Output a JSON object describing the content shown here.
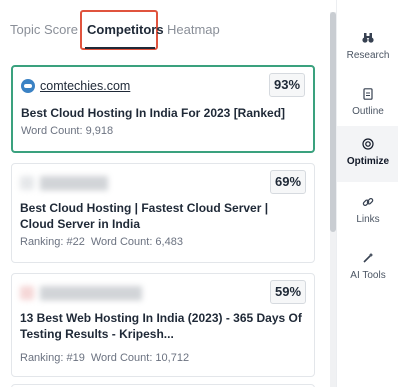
{
  "tabs": {
    "topic_score": "Topic Score",
    "competitors": "Competitors",
    "heatmap": "Heatmap"
  },
  "cards": [
    {
      "site": "comtechies.com",
      "score": "93%",
      "title": "Best Cloud Hosting In India For 2023 [Ranked]",
      "word_count": "Word Count: 9,918"
    },
    {
      "score": "69%",
      "title": "Best Cloud Hosting | Fastest Cloud Server | Cloud Server in India",
      "ranking": "Ranking: #22",
      "word_count": "Word Count: 6,483"
    },
    {
      "score": "59%",
      "title": "13 Best Web Hosting In India (2023) - 365 Days Of Testing Results - Kripesh...",
      "ranking": "Ranking: #19",
      "word_count": "Word Count: 10,712"
    }
  ],
  "sidebar": {
    "items": [
      {
        "label": "Research",
        "icon": "binoculars-icon"
      },
      {
        "label": "Outline",
        "icon": "document-icon"
      },
      {
        "label": "Optimize",
        "icon": "target-icon"
      },
      {
        "label": "Links",
        "icon": "link-icon"
      },
      {
        "label": "AI Tools",
        "icon": "magic-wand-icon"
      }
    ]
  },
  "colors": {
    "active_border": "#3aa17e",
    "highlight_box": "#e0533d",
    "site_icon": "#3b82c4"
  }
}
